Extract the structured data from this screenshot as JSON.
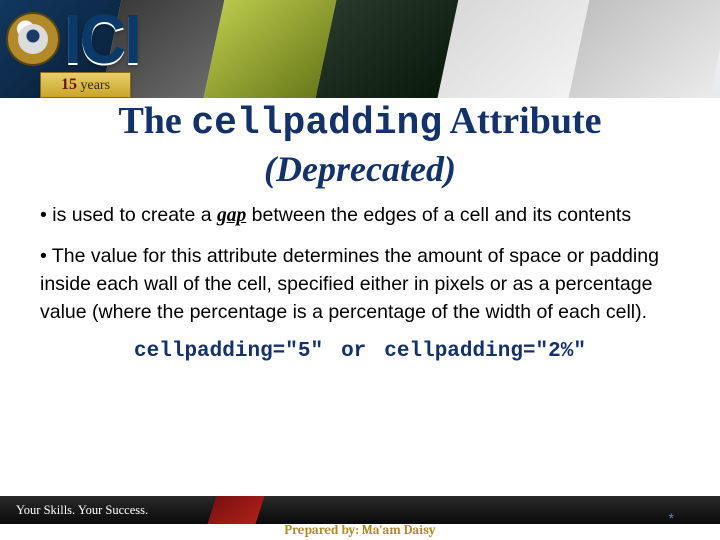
{
  "header": {
    "logo_text": "ICI",
    "ribbon_years": "15",
    "ribbon_label": "years"
  },
  "title": {
    "prefix": "The ",
    "code": "cellpadding",
    "suffix": " Attribute"
  },
  "subtitle": "(Deprecated)",
  "bullets": [
    {
      "pre": "• is used to create a ",
      "em": "gap",
      "post": " between the edges of a cell and its contents"
    },
    {
      "text": "• The value for this attribute determines the amount of space or padding inside each wall of the cell, specified either in pixels or as a percentage value (where the percentage is a percentage of the width of each cell)."
    }
  ],
  "examples": {
    "ex1": "cellpadding=\"5\"",
    "sep": "or",
    "ex2": "cellpadding=\"2%\""
  },
  "footer": {
    "tagline": "Your Skills. Your Success.",
    "prepared": "Prepared by: Ma'am Daisy",
    "pagenum": "*"
  }
}
